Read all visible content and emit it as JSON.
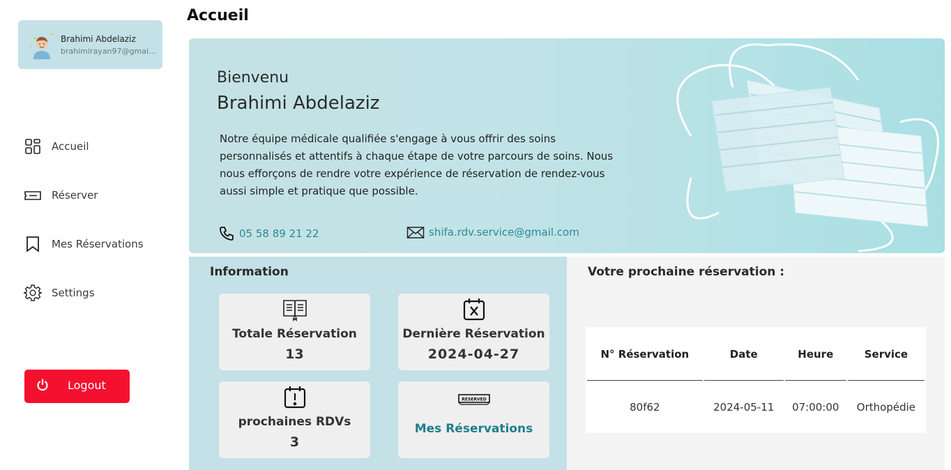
{
  "user": {
    "name": "Brahimi Abdelaziz",
    "email": "brahimirayan97@gmail.com"
  },
  "sidebar": {
    "items": [
      {
        "label": "Accueil",
        "icon": "dashboard-icon"
      },
      {
        "label": "Réserver",
        "icon": "ticket-icon"
      },
      {
        "label": "Mes Réservations",
        "icon": "bookmark-icon"
      },
      {
        "label": "Settings",
        "icon": "gear-icon"
      }
    ],
    "logout_label": "Logout"
  },
  "page": {
    "title": "Accueil"
  },
  "hero": {
    "welcome": "Bienvenu",
    "name": "Brahimi Abdelaziz",
    "text": "Notre équipe médicale qualifiée s'engage à vous offrir des soins personnalisés et attentifs à chaque étape de votre parcours de soins. Nous nous efforçons de rendre votre expérience de réservation de rendez-vous aussi simple et pratique que possible.",
    "phone": "05 58 89 21 22",
    "email": "shifa.rdv.service@gmail.com"
  },
  "info": {
    "title": "Information",
    "cards": [
      {
        "label": "Totale Réservation",
        "value": "13"
      },
      {
        "label": "Dernière Réservation",
        "value": "2024-04-27"
      },
      {
        "label": "prochaines RDVs",
        "value": "3"
      },
      {
        "label": "Mes Réservations"
      }
    ]
  },
  "next_reservation": {
    "title": "Votre prochaine réservation :",
    "columns": [
      "N° Réservation",
      "Date",
      "Heure",
      "Service"
    ],
    "rows": [
      [
        "80f62",
        "2024-05-11",
        "07:00:00",
        "Orthopédie"
      ]
    ]
  },
  "colors": {
    "accent": "#c3e1e6",
    "link": "#1f7f8c",
    "logout": "#f4112f"
  }
}
